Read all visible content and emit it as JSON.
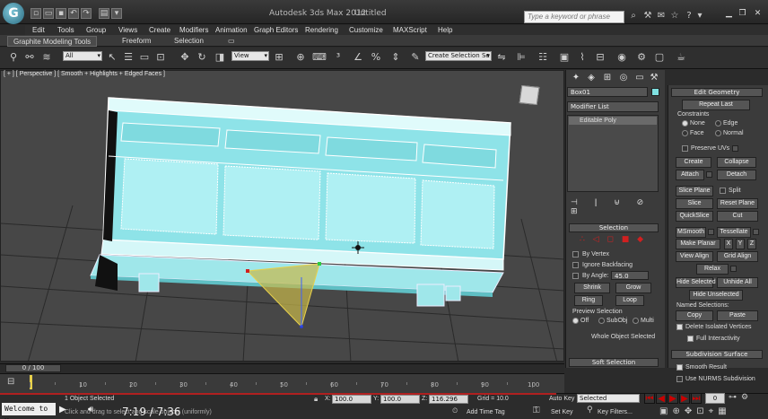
{
  "window": {
    "app_title": "Autodesk 3ds Max 2012",
    "file_title": "Untitled",
    "search_placeholder": "Type a keyword or phrase"
  },
  "menu": [
    "Edit",
    "Tools",
    "Group",
    "Views",
    "Create",
    "Modifiers",
    "Animation",
    "Graph Editors",
    "Rendering",
    "Customize",
    "MAXScript",
    "Help"
  ],
  "ribbon": {
    "tabs": [
      "Graphite Modeling Tools",
      "Freeform",
      "Selection"
    ]
  },
  "toolbar": {
    "filter_value": "All",
    "refcoord_value": "View",
    "selection_set_placeholder": "Create Selection Se"
  },
  "viewport": {
    "label": "[ + ] [ Perspective ] [ Smooth + Highlights + Edged Faces ]"
  },
  "command_panel": {
    "object_name": "Box01",
    "modifier_list": "Modifier List",
    "stack_item": "Editable Poly",
    "selection": {
      "header": "Selection",
      "by_vertex": "By Vertex",
      "ignore_backfacing": "Ignore Backfacing",
      "by_angle": "By Angle:",
      "by_angle_value": "45.0",
      "shrink": "Shrink",
      "grow": "Grow",
      "ring": "Ring",
      "loop": "Loop",
      "preview_selection": "Preview Selection",
      "off": "Off",
      "subobj": "SubObj",
      "multi": "Multi",
      "whole_object": "Whole Object Selected"
    },
    "soft_selection": "Soft Selection"
  },
  "edit_geometry": {
    "header": "Edit Geometry",
    "repeat_last": "Repeat Last",
    "constraints": "Constraints",
    "none": "None",
    "edge": "Edge",
    "face": "Face",
    "normal": "Normal",
    "preserve_uvs": "Preserve UVs",
    "create": "Create",
    "collapse": "Collapse",
    "attach": "Attach",
    "detach": "Detach",
    "slice_plane": "Slice Plane",
    "split": "Split",
    "slice": "Slice",
    "reset_plane": "Reset Plane",
    "quickslice": "QuickSlice",
    "cut": "Cut",
    "msmooth": "MSmooth",
    "tessellate": "Tessellate",
    "make_planar": "Make Planar",
    "x": "X",
    "y": "Y",
    "z": "Z",
    "view_align": "View Align",
    "grid_align": "Grid Align",
    "relax": "Relax",
    "hide_selected": "Hide Selected",
    "unhide_all": "Unhide All",
    "hide_unselected": "Hide Unselected",
    "named_selections": "Named Selections:",
    "copy": "Copy",
    "paste": "Paste",
    "delete_isolated": "Delete Isolated Vertices",
    "full_interactivity": "Full Interactivity",
    "subdivision_header": "Subdivision Surface",
    "smooth_result": "Smooth Result",
    "use_nurms": "Use NURMS Subdivision"
  },
  "timeline": {
    "frame_counter": "0 / 100",
    "ticks": [
      "10",
      "20",
      "30",
      "40",
      "50",
      "60",
      "70",
      "80",
      "90",
      "100"
    ]
  },
  "status": {
    "selected_text": "1 Object Selected",
    "prompt_text": "Click and drag to select and scale objects (uniformly)",
    "x_label": "X:",
    "x_value": "100.0",
    "y_label": "Y:",
    "y_value": "100.0",
    "z_label": "Z:",
    "z_value": "116.296",
    "grid": "Grid = 10.0",
    "add_time_tag": "Add Time Tag",
    "auto_key": "Auto Key",
    "auto_key_dropdown": "Selected",
    "set_key": "Set Key",
    "key_filters": "Key Filters...",
    "welcome": "Welcome to M",
    "play_time": "7:19 / 7:36"
  },
  "colors": {
    "object_color": "#7fe0e0",
    "selection_red": "#d02020"
  }
}
